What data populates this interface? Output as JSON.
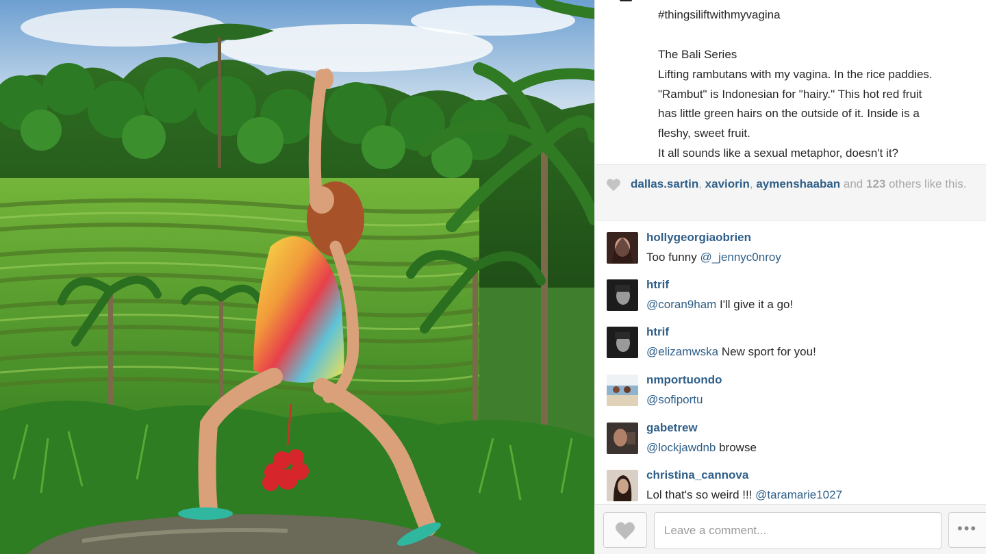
{
  "photo": {
    "alt_icon": "photo-image"
  },
  "caption": {
    "lines": [
      "#thingsiliftwithmyvagina",
      "",
      "The Bali Series",
      "Lifting rambutans with my vagina. In the rice paddies.",
      "\"Rambut\" is Indonesian for \"hairy.\" This hot red fruit",
      "has little green hairs on the outside of it. Inside is a",
      "fleshy, sweet fruit.",
      "It all sounds like a sexual metaphor, doesn't it?"
    ]
  },
  "likes": {
    "icon": "heart-icon",
    "users": [
      "dallas.sartin",
      "xaviorin",
      "aymenshaaban"
    ],
    "sep1": ", ",
    "sep2": ", ",
    "and_text": " and ",
    "count": "123",
    "rest": " others like this."
  },
  "comments": [
    {
      "user": "hollygeorgiaobrien",
      "text": "Too funny ",
      "mention": "@_jennyc0nroy",
      "after": ""
    },
    {
      "user": "htrif",
      "text": "",
      "mention": "@coran9ham",
      "after": " I'll give it a go!"
    },
    {
      "user": "htrif",
      "text": "",
      "mention": "@elizamwska",
      "after": " New sport for you!"
    },
    {
      "user": "nmportuondo",
      "text": "",
      "mention": "@sofiportu",
      "after": ""
    },
    {
      "user": "gabetrew",
      "text": "",
      "mention": "@lockjawdnb",
      "after": " browse"
    },
    {
      "user": "christina_cannova",
      "text": "Lol that's so weird !!! ",
      "mention": "@taramarie1027",
      "after": ""
    }
  ],
  "bottom": {
    "comment_placeholder": "Leave a comment...",
    "more_label": "•••",
    "like_icon": "heart-icon"
  },
  "colors": {
    "link": "#2f5f88",
    "muted": "#a8a8a8",
    "text": "#262626",
    "panel_bg": "#f5f5f5"
  }
}
